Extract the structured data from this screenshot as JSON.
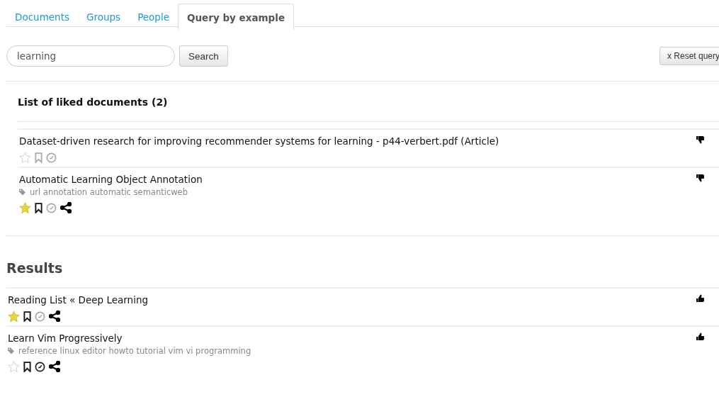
{
  "tabs": [
    {
      "label": "Documents",
      "selected": false
    },
    {
      "label": "Groups",
      "selected": false
    },
    {
      "label": "People",
      "selected": false
    },
    {
      "label": "Query by example",
      "selected": true
    }
  ],
  "search": {
    "value": "learning",
    "button": "Search"
  },
  "reset_button": "x Reset query",
  "liked": {
    "title": "List of liked documents (2)",
    "kind": "down",
    "documents": [
      {
        "title": "Dataset-driven research for improving recommender systems for learning - p44-verbert.pdf (Article)",
        "starred": false,
        "bookmarked": false,
        "read_later": false,
        "shareable": false
      },
      {
        "title": "Automatic Learning Object Annotation",
        "tags": "url annotation automatic semanticweb",
        "starred": true,
        "bookmarked": true,
        "read_later": false,
        "shareable": true
      }
    ]
  },
  "results": {
    "title": "Results",
    "kind": "up",
    "documents": [
      {
        "title": "Reading List « Deep Learning",
        "starred": true,
        "bookmarked": true,
        "read_later": false,
        "shareable": true
      },
      {
        "title": "Learn Vim Progressively",
        "tags": "reference linux editor howto tutorial vim vi programming",
        "starred": false,
        "bookmarked": true,
        "read_later": true,
        "shareable": true
      }
    ]
  }
}
